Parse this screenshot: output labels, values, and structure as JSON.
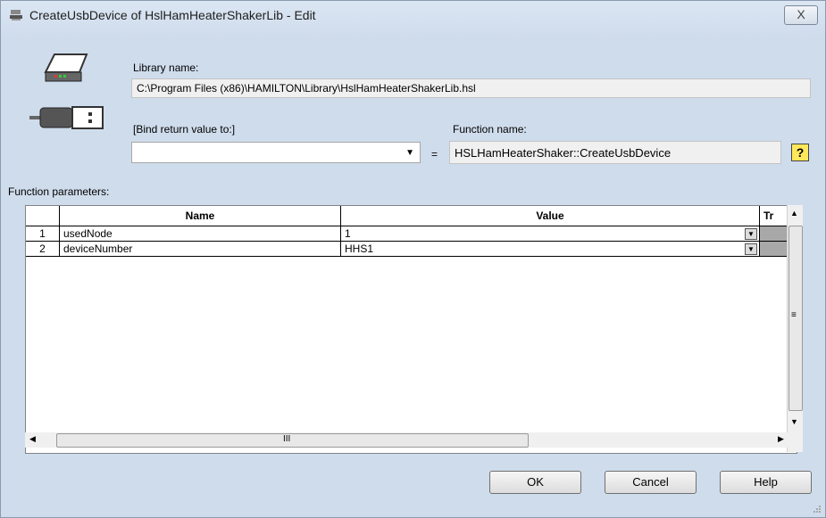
{
  "window": {
    "title": "CreateUsbDevice of HslHamHeaterShakerLib - Edit",
    "close_glyph": "X"
  },
  "library": {
    "label": "Library name:",
    "path": "C:\\Program Files (x86)\\HAMILTON\\Library\\HslHamHeaterShakerLib.hsl"
  },
  "bind": {
    "label": "[Bind return value to:]",
    "value": "",
    "equals": "="
  },
  "function": {
    "label": "Function name:",
    "name": "HSLHamHeaterShaker::CreateUsbDevice",
    "help_glyph": "?"
  },
  "params": {
    "label": "Function parameters:",
    "columns": [
      "Name",
      "Value",
      "Tr"
    ],
    "rows": [
      {
        "num": "1",
        "name": "usedNode",
        "value": "1"
      },
      {
        "num": "2",
        "name": "deviceNumber",
        "value": "HHS1"
      }
    ],
    "hscroll_thumb_glyph": "III",
    "vscroll_thumb_glyph": "≡"
  },
  "buttons": {
    "ok": "OK",
    "cancel": "Cancel",
    "help": "Help"
  }
}
